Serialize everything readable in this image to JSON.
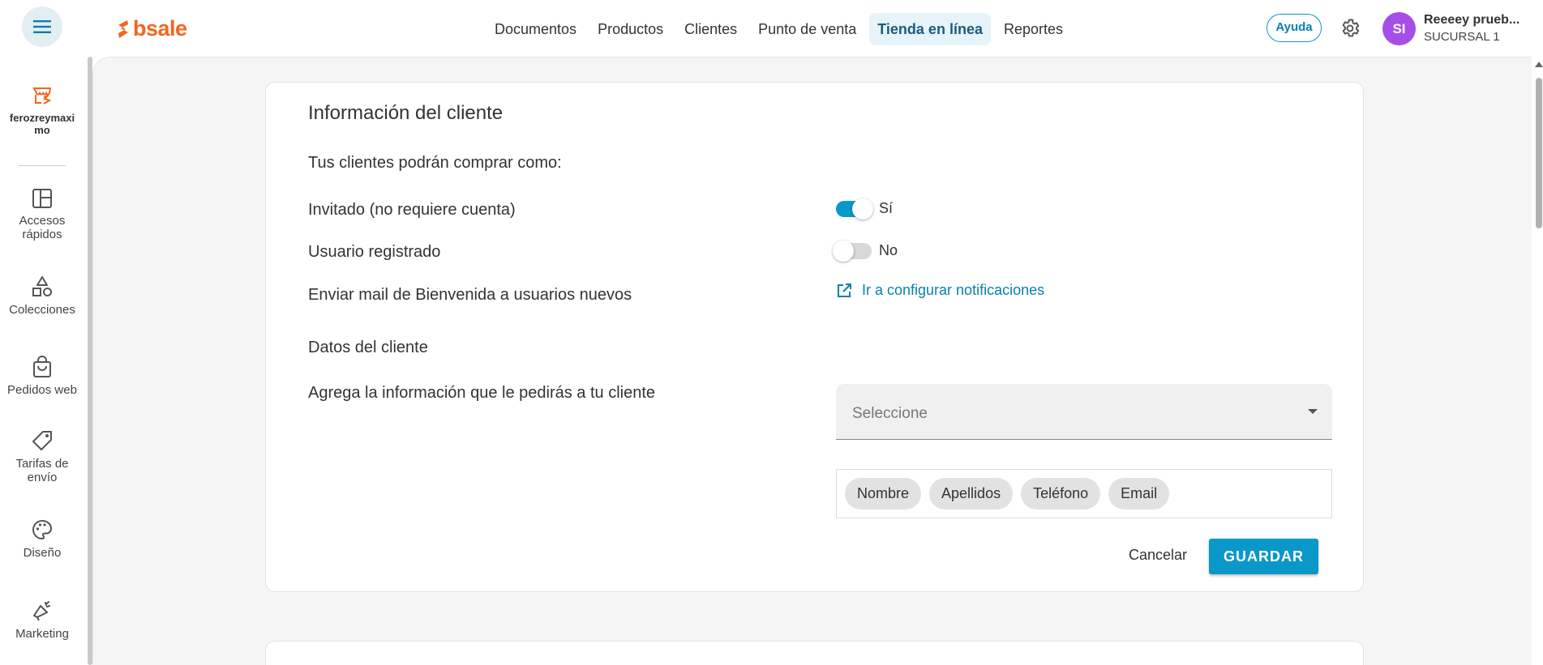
{
  "header": {
    "brand": "bsale",
    "nav": [
      {
        "label": "Documentos"
      },
      {
        "label": "Productos"
      },
      {
        "label": "Clientes"
      },
      {
        "label": "Punto de venta"
      },
      {
        "label": "Tienda en línea"
      },
      {
        "label": "Reportes"
      }
    ],
    "help_label": "Ayuda",
    "user": {
      "initials": "SI",
      "name": "Reeeey prueb...",
      "branch": "SUCURSAL 1"
    }
  },
  "sidebar": {
    "store_name": "ferozreymaximo",
    "items": [
      {
        "label": "Accesos rápidos",
        "icon": "layout-icon"
      },
      {
        "label": "Colecciones",
        "icon": "shapes-icon"
      },
      {
        "label": "Pedidos web",
        "icon": "shopping-bag-icon"
      },
      {
        "label": "Tarifas de envío",
        "icon": "tag-icon"
      },
      {
        "label": "Diseño",
        "icon": "palette-icon"
      },
      {
        "label": "Marketing",
        "icon": "megaphone-icon"
      }
    ]
  },
  "card": {
    "title": "Información del cliente",
    "buy_as_label": "Tus clientes podrán comprar como:",
    "guest": {
      "label": "Invitado (no requiere cuenta)",
      "state": "Sí",
      "on": true
    },
    "registered": {
      "label": "Usuario registrado",
      "state": "No",
      "on": false
    },
    "welcome_mail": {
      "label": "Enviar mail de Bienvenida a usuarios nuevos",
      "link": "Ir a configurar notificaciones"
    },
    "customer_data_title": "Datos del cliente",
    "customer_data_desc": "Agrega la información que le pedirás a tu cliente",
    "select_placeholder": "Seleccione",
    "chips": [
      "Nombre",
      "Apellidos",
      "Teléfono",
      "Email"
    ],
    "cancel_label": "Cancelar",
    "save_label": "GUARDAR"
  },
  "colors": {
    "accent": "#0a98c9",
    "brand": "#f26522",
    "avatar": "#a64ee8"
  }
}
